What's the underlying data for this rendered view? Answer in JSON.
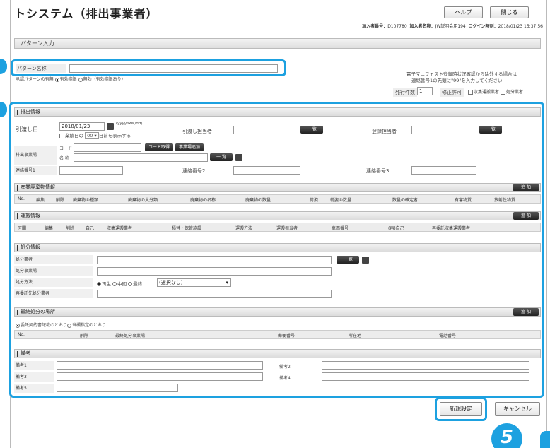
{
  "header": {
    "title": "トシステム（排出事業者）",
    "help": "ヘルプ",
    "close": "閉じる",
    "info_parts": [
      {
        "k": "加入者番号：",
        "v": "D107780"
      },
      {
        "k": "加入者名称：",
        "v": "JW説明会用194"
      },
      {
        "k": "ログイン時刻：",
        "v": "2018/01/23 15:37:56"
      }
    ]
  },
  "page_bar": "パターン入力",
  "pattern": {
    "name_label": "パターン名称",
    "name_value": "",
    "approval_label": "承認パターンの有無",
    "approval_opt1": "有効期限",
    "approval_opt2": "無効（有効期限あり）"
  },
  "notice": {
    "line1": "電子マニフェスト登録時状況確認から除外する場合は",
    "line2": "連絡番号1の先頭に\"99\"を入力してください"
  },
  "issue": {
    "count_label": "発行件数",
    "count_value": "1",
    "edit_label": "修正許可",
    "cb1": "収集運搬業者",
    "cb2": "処分業者"
  },
  "emission": {
    "section": "排出情報",
    "date_label": "引渡し日",
    "date_value": "2018/01/23",
    "date_hint": "(yyyy/MM/dd)",
    "holiday_label": "業績日の",
    "holiday_value": "00",
    "holiday_suffix": "日前を表示する",
    "person_label": "引渡し担当者",
    "list_btn": "一 覧",
    "registrar_label": "登録担当者",
    "site_label": "排出事業場",
    "code_label": "コード",
    "code_btn": "コード取得",
    "site_btn": "事業場追加",
    "name_label": "名 称",
    "contact1": "連絡番号1",
    "contact2": "連絡番号2",
    "contact3": "連絡番号3"
  },
  "industrial": {
    "section": "産業廃棄物情報",
    "add": "追 加",
    "cols": [
      "No.",
      "編集",
      "削除",
      "廃棄物の種類",
      "廃棄物の大分類",
      "廃棄物の名称",
      "廃棄物の数量",
      "荷姿",
      "荷姿の数量",
      "数量の確定者",
      "有害物質",
      "放射性物質"
    ]
  },
  "transport": {
    "section": "運搬情報",
    "add": "追 加",
    "cols": [
      "区間",
      "編集",
      "削除",
      "自己",
      "収集運搬業者",
      "積替・保管施設",
      "運搬方法",
      "運搬担当者",
      "車両番号",
      "(再)自己",
      "再委託収集運搬業者"
    ]
  },
  "disposal": {
    "section": "処分情報",
    "company_label": "処分業者",
    "list_btn": "一 覧",
    "site_label": "処分事業場",
    "method_label": "処分方法",
    "m1": "再生",
    "m2": "中間",
    "m3": "最終",
    "select_value": "(選択なし)",
    "recon_label": "再委託先処分業者"
  },
  "final": {
    "section": "最終処分の場所",
    "add": "追 加",
    "opt1": "委託契約書記載のとおり",
    "opt2": "当欄指定のとおり",
    "cols": [
      "No.",
      "削除",
      "最終処分事業場",
      "郵便番号",
      "所在地",
      "電話番号"
    ]
  },
  "remarks": {
    "section": "備考",
    "r1": "備考1",
    "r2": "備考2",
    "r3": "備考3",
    "r4": "備考4",
    "r5": "備考5"
  },
  "footer": {
    "submit": "新規設定",
    "cancel": "キャンセル"
  },
  "badges": {
    "five": "5"
  },
  "colors": {
    "accent": "#1da1e0"
  }
}
